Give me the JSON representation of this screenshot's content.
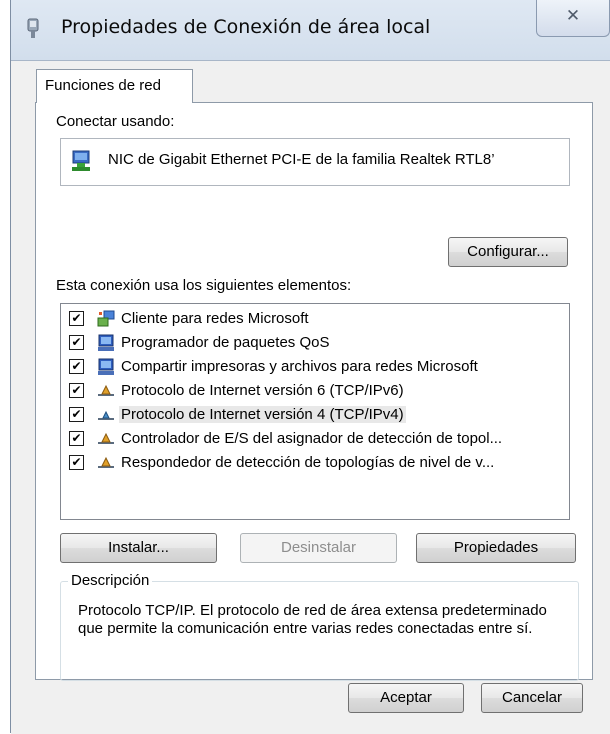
{
  "window": {
    "title": "Propiedades de Conexión de área local",
    "close_glyph": "✕"
  },
  "tabs": [
    {
      "label": "Funciones de red",
      "active": true
    }
  ],
  "connect": {
    "label": "Conectar usando:",
    "adapter_name": "NIC de Gigabit Ethernet PCI-E de la familia Realtek RTL8’",
    "adapter_icon": "network-adapter-icon",
    "configure_label": "Configurar..."
  },
  "elements": {
    "label": "Esta conexión usa los siguientes elementos:",
    "items": [
      {
        "label": "Cliente para redes Microsoft",
        "checked": true,
        "icon": "client-network-icon"
      },
      {
        "label": "Programador de paquetes QoS",
        "checked": true,
        "icon": "service-icon"
      },
      {
        "label": "Compartir impresoras y archivos para redes Microsoft",
        "checked": true,
        "icon": "service-icon"
      },
      {
        "label": "Protocolo de Internet versión 6 (TCP/IPv6)",
        "checked": true,
        "icon": "protocol-icon"
      },
      {
        "label": "Protocolo de Internet versión 4 (TCP/IPv4)",
        "checked": true,
        "icon": "protocol-icon",
        "selected": true
      },
      {
        "label": "Controlador de E/S del asignador de detección de topol...",
        "checked": true,
        "icon": "protocol-icon"
      },
      {
        "label": "Respondedor de detección de topologías de nivel de v...",
        "checked": true,
        "icon": "protocol-icon"
      }
    ],
    "check_glyph": "✔"
  },
  "actions": {
    "install": "Instalar...",
    "uninstall": "Desinstalar",
    "properties": "Propiedades"
  },
  "description": {
    "title": "Descripción",
    "text": "Protocolo TCP/IP. El protocolo de red de área extensa predeterminado que permite la comunicación entre varias redes conectadas entre sí."
  },
  "footer": {
    "accept": "Aceptar",
    "cancel": "Cancelar"
  },
  "colors": {
    "titlebar": "#d2deec",
    "client": "#f0f0f0",
    "selection": "#e8e8e8"
  }
}
